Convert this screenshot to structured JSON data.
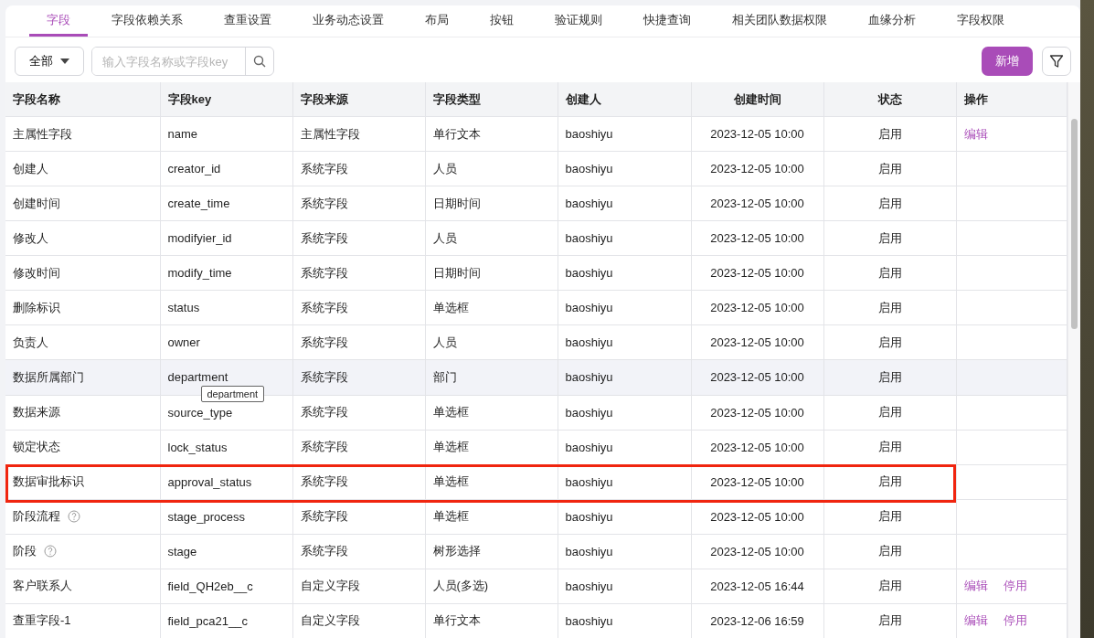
{
  "tabs": [
    {
      "label": "字段",
      "selected": true
    },
    {
      "label": "字段依赖关系",
      "selected": false
    },
    {
      "label": "查重设置",
      "selected": false
    },
    {
      "label": "业务动态设置",
      "selected": false
    },
    {
      "label": "布局",
      "selected": false
    },
    {
      "label": "按钮",
      "selected": false
    },
    {
      "label": "验证规则",
      "selected": false
    },
    {
      "label": "快捷查询",
      "selected": false
    },
    {
      "label": "相关团队数据权限",
      "selected": false
    },
    {
      "label": "血缘分析",
      "selected": false
    },
    {
      "label": "字段权限",
      "selected": false
    }
  ],
  "toolbar": {
    "filter_select": "全部",
    "search": {
      "placeholder": "输入字段名称或字段key"
    },
    "add_button": "新增"
  },
  "table": {
    "columns": [
      "字段名称",
      "字段key",
      "字段来源",
      "字段类型",
      "创建人",
      "创建时间",
      "状态",
      "操作"
    ],
    "rows": [
      {
        "cells": [
          "主属性字段",
          "name",
          "主属性字段",
          "单行文本",
          "baoshiyu",
          "2023-12-05 10:00",
          "启用"
        ],
        "help": false,
        "hovered": false,
        "outlined": false,
        "actions": [
          "编辑"
        ]
      },
      {
        "cells": [
          "创建人",
          "creator_id",
          "系统字段",
          "人员",
          "baoshiyu",
          "2023-12-05 10:00",
          "启用"
        ],
        "help": false,
        "hovered": false,
        "outlined": false,
        "actions": []
      },
      {
        "cells": [
          "创建时间",
          "create_time",
          "系统字段",
          "日期时间",
          "baoshiyu",
          "2023-12-05 10:00",
          "启用"
        ],
        "help": false,
        "hovered": false,
        "outlined": false,
        "actions": []
      },
      {
        "cells": [
          "修改人",
          "modifyier_id",
          "系统字段",
          "人员",
          "baoshiyu",
          "2023-12-05 10:00",
          "启用"
        ],
        "help": false,
        "hovered": false,
        "outlined": false,
        "actions": []
      },
      {
        "cells": [
          "修改时间",
          "modify_time",
          "系统字段",
          "日期时间",
          "baoshiyu",
          "2023-12-05 10:00",
          "启用"
        ],
        "help": false,
        "hovered": false,
        "outlined": false,
        "actions": []
      },
      {
        "cells": [
          "删除标识",
          "status",
          "系统字段",
          "单选框",
          "baoshiyu",
          "2023-12-05 10:00",
          "启用"
        ],
        "help": false,
        "hovered": false,
        "outlined": false,
        "actions": []
      },
      {
        "cells": [
          "负责人",
          "owner",
          "系统字段",
          "人员",
          "baoshiyu",
          "2023-12-05 10:00",
          "启用"
        ],
        "help": false,
        "hovered": false,
        "outlined": false,
        "actions": []
      },
      {
        "cells": [
          "数据所属部门",
          "department",
          "系统字段",
          "部门",
          "baoshiyu",
          "2023-12-05 10:00",
          "启用"
        ],
        "help": false,
        "hovered": true,
        "outlined": false,
        "actions": [],
        "tooltip": "department"
      },
      {
        "cells": [
          "数据来源",
          "source_type",
          "系统字段",
          "单选框",
          "baoshiyu",
          "2023-12-05 10:00",
          "启用"
        ],
        "help": false,
        "hovered": false,
        "outlined": false,
        "actions": []
      },
      {
        "cells": [
          "锁定状态",
          "lock_status",
          "系统字段",
          "单选框",
          "baoshiyu",
          "2023-12-05 10:00",
          "启用"
        ],
        "help": false,
        "hovered": false,
        "outlined": false,
        "actions": []
      },
      {
        "cells": [
          "数据审批标识",
          "approval_status",
          "系统字段",
          "单选框",
          "baoshiyu",
          "2023-12-05 10:00",
          "启用"
        ],
        "help": false,
        "hovered": false,
        "outlined": true,
        "actions": []
      },
      {
        "cells": [
          "阶段流程",
          "stage_process",
          "系统字段",
          "单选框",
          "baoshiyu",
          "2023-12-05 10:00",
          "启用"
        ],
        "help": true,
        "hovered": false,
        "outlined": false,
        "actions": []
      },
      {
        "cells": [
          "阶段",
          "stage",
          "系统字段",
          "树形选择",
          "baoshiyu",
          "2023-12-05 10:00",
          "启用"
        ],
        "help": true,
        "hovered": false,
        "outlined": false,
        "actions": []
      },
      {
        "cells": [
          "客户联系人",
          "field_QH2eb__c",
          "自定义字段",
          "人员(多选)",
          "baoshiyu",
          "2023-12-05 16:44",
          "启用"
        ],
        "help": false,
        "hovered": false,
        "outlined": false,
        "actions": [
          "编辑",
          "停用"
        ]
      },
      {
        "cells": [
          "查重字段-1",
          "field_pca21__c",
          "自定义字段",
          "单行文本",
          "baoshiyu",
          "2023-12-06 16:59",
          "启用"
        ],
        "help": false,
        "hovered": false,
        "outlined": false,
        "actions": [
          "编辑",
          "停用"
        ]
      }
    ]
  }
}
